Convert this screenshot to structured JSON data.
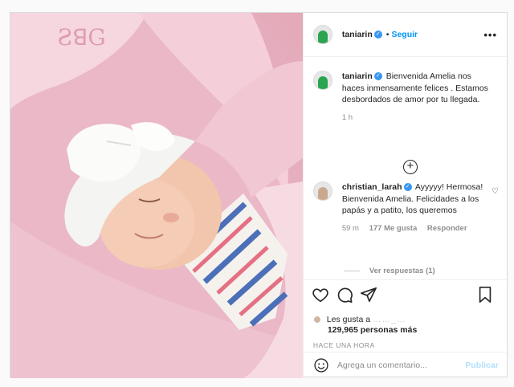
{
  "post": {
    "username": "taniarin",
    "follow_label": "Seguir",
    "more_label": "•••",
    "caption": "Bienvenida Amelia nos haces inmensamente felices . Estamos desbordados de amor por tu llegada.",
    "caption_time": "1 h",
    "load_more_icon": "plus-circle-icon"
  },
  "comments": [
    {
      "username": "christian_larah",
      "text": "Ayyyyy! Hermosa! Bienvenida Amelia. Felicidades a los papás y a patito, los queremos",
      "time": "59 m",
      "likes": "177 Me gusta",
      "reply_label": "Responder",
      "view_replies": "Ver respuestas (1)"
    }
  ],
  "likes": {
    "liked_by": "Les gusta a",
    "count": "129,965 personas más"
  },
  "timestamp": "HACE UNA HORA",
  "add_comment": {
    "placeholder": "Agrega un comentario...",
    "publish_label": "Publicar"
  },
  "colors": {
    "accent": "#0095f6",
    "verified": "#3897f0",
    "publish_disabled": "#b2dffc"
  }
}
